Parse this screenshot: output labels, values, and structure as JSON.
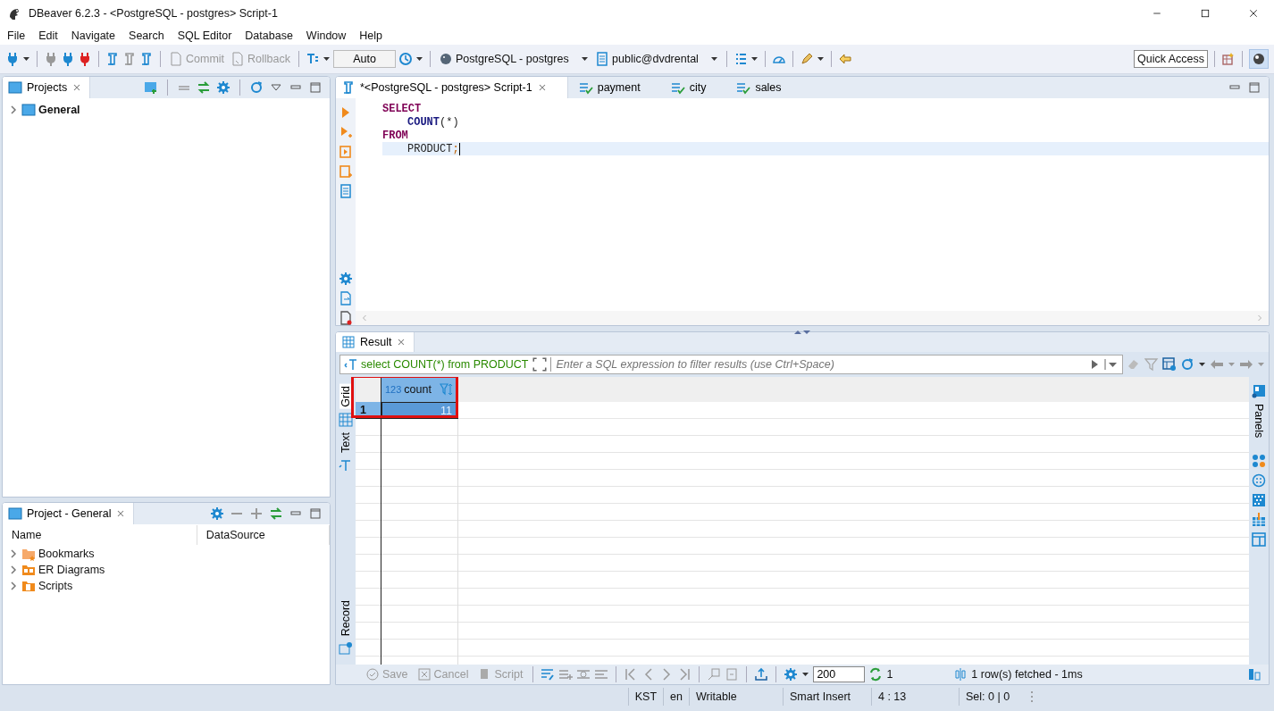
{
  "window": {
    "title": "DBeaver 6.2.3 - <PostgreSQL - postgres> Script-1"
  },
  "menu": [
    "File",
    "Edit",
    "Navigate",
    "Search",
    "SQL Editor",
    "Database",
    "Window",
    "Help"
  ],
  "toolbar": {
    "commit": {
      "label": "Commit",
      "disabled": true
    },
    "rollback": {
      "label": "Rollback",
      "disabled": true
    },
    "mode": "Auto",
    "connection": "PostgreSQL - postgres",
    "schema": "public@dvdrental",
    "quick_access": "Quick Access"
  },
  "projects_panel": {
    "title": "Projects",
    "tree": [
      {
        "label": "General",
        "expanded": false
      }
    ]
  },
  "project_general": {
    "title": "Project - General",
    "columns": [
      "Name",
      "DataSource"
    ],
    "items": [
      {
        "label": "Bookmarks",
        "kind": "bookmarks",
        "expanded": false
      },
      {
        "label": "ER Diagrams",
        "kind": "diagrams",
        "expanded": false
      },
      {
        "label": "Scripts",
        "kind": "scripts",
        "expanded": false
      }
    ]
  },
  "editor_tabs": [
    {
      "label": "*<PostgreSQL - postgres> Script-1",
      "kind": "script",
      "selected": true
    },
    {
      "label": "payment",
      "kind": "table",
      "selected": false
    },
    {
      "label": "city",
      "kind": "table",
      "selected": false
    },
    {
      "label": "sales",
      "kind": "table",
      "selected": false
    }
  ],
  "sql_lines": [
    {
      "indented": false,
      "current": false,
      "tokens": [
        {
          "kind": "keyword",
          "text": "SELECT"
        }
      ]
    },
    {
      "indented": true,
      "current": false,
      "tokens": [
        {
          "kind": "function",
          "text": "COUNT"
        },
        {
          "kind": "plain",
          "text": "(*)"
        }
      ]
    },
    {
      "indented": false,
      "current": false,
      "tokens": [
        {
          "kind": "keyword",
          "text": "FROM"
        }
      ]
    },
    {
      "indented": true,
      "current": true,
      "tokens": [
        {
          "kind": "identifier",
          "text": "PRODUCT"
        },
        {
          "kind": "punct",
          "text": ";"
        }
      ]
    }
  ],
  "results": {
    "tab": "Result",
    "query": "select COUNT(*) from PRODUCT",
    "filter_placeholder": "Enter a SQL expression to filter results (use Ctrl+Space)",
    "column": {
      "type": "123",
      "name": "count",
      "selected": true
    },
    "rows": [
      {
        "number": "1",
        "value": "11",
        "selected": true
      }
    ],
    "side_tabs": [
      {
        "label": "Grid",
        "selected": true
      },
      {
        "label": "Text",
        "selected": false
      },
      {
        "label": "Record",
        "selected": false
      }
    ],
    "panels_label": "Panels",
    "actions": [
      {
        "label": "Save",
        "kind": "save",
        "disabled": true
      },
      {
        "label": "Cancel",
        "kind": "cancel",
        "disabled": true
      },
      {
        "label": "Script",
        "kind": "script",
        "disabled": true
      }
    ],
    "fetch_size": "200",
    "refresh_count": "1",
    "status": "1 row(s) fetched - 1ms"
  },
  "status_bar": [
    "KST",
    "en",
    "Writable",
    "Smart Insert",
    "4 : 13",
    "Sel: 0 | 0"
  ]
}
